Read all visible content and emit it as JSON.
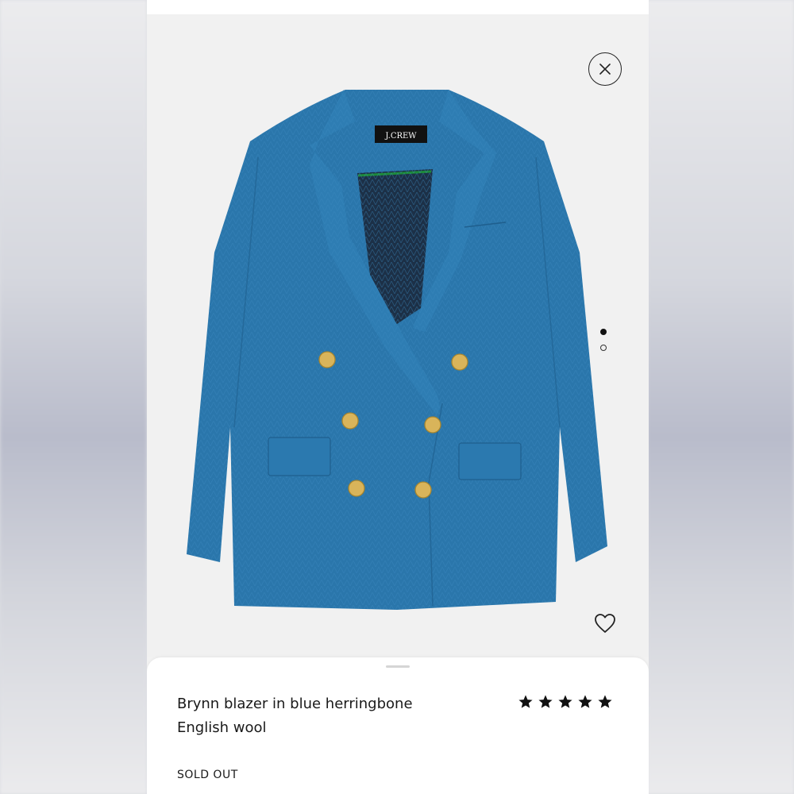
{
  "product": {
    "brand_label": "J.CREW",
    "title_line1": "Brynn blazer in blue herringbone",
    "title_line2": "English wool",
    "status": "SOLD OUT",
    "rating": 5,
    "rating_max": 5,
    "image_count": 2,
    "active_image_index": 0
  },
  "icons": {
    "close": "close-icon",
    "favorite": "heart-icon",
    "rating_star": "star-icon"
  },
  "colors": {
    "blazer": "#2c78ad",
    "button_gold": "#d9b45a",
    "lining": "#1c3047",
    "lining_trim": "#1d8a3a"
  }
}
